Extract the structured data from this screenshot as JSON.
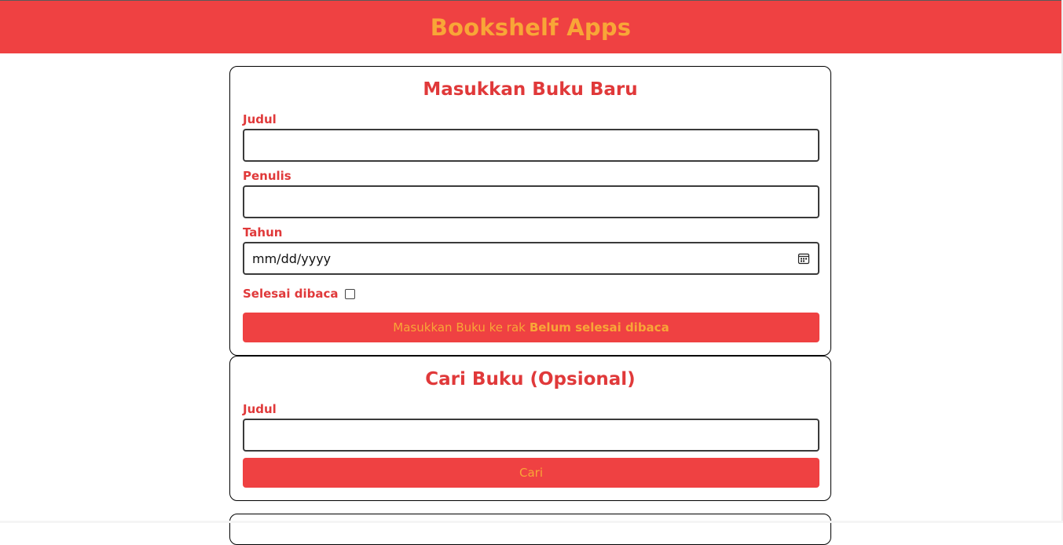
{
  "header": {
    "title": "Bookshelf Apps"
  },
  "input_section": {
    "heading": "Masukkan Buku Baru",
    "title_label": "Judul",
    "title_value": "",
    "author_label": "Penulis",
    "author_value": "",
    "year_label": "Tahun",
    "year_placeholder": "mm/dd/yyyy",
    "complete_label": "Selesai dibaca",
    "complete_checked": false,
    "submit_prefix": "Masukkan Buku ke rak",
    "submit_bold": "Belum selesai dibaca"
  },
  "search_section": {
    "heading": "Cari Buku (Opsional)",
    "title_label": "Judul",
    "title_value": "",
    "submit_label": "Cari"
  },
  "icons": {
    "date_picker": "calendar-icon"
  },
  "colors": {
    "primary": "#ef4142",
    "accent": "#f8a637",
    "heading": "#e0393a"
  }
}
